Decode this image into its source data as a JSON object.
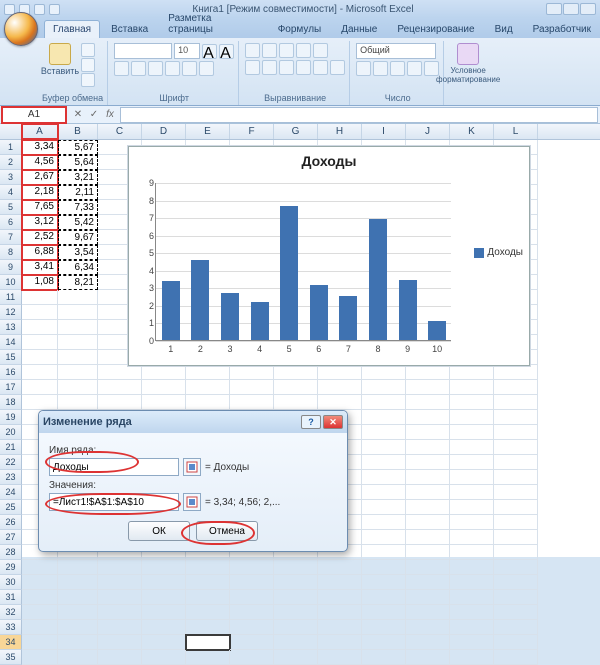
{
  "title": "Книга1  [Режим совместимости] - Microsoft Excel",
  "tabs": [
    "Главная",
    "Вставка",
    "Разметка страницы",
    "Формулы",
    "Данные",
    "Рецензирование",
    "Вид",
    "Разработчик"
  ],
  "active_tab": 0,
  "ribbon": {
    "clipboard": {
      "label": "Буфер обмена",
      "paste": "Вставить"
    },
    "font": {
      "label": "Шрифт",
      "name": "",
      "size": "10"
    },
    "align": {
      "label": "Выравнивание"
    },
    "number": {
      "label": "Число",
      "fmt": "Общий"
    },
    "styles": {
      "label": "",
      "cond": "Условное форматирование"
    }
  },
  "namebox": "A1",
  "columns": [
    "A",
    "B",
    "C",
    "D",
    "E",
    "F",
    "G",
    "H",
    "I",
    "J",
    "K",
    "L"
  ],
  "rows": [
    "1",
    "2",
    "3",
    "4",
    "5",
    "6",
    "7",
    "8",
    "9",
    "10",
    "11",
    "12",
    "13",
    "14",
    "15",
    "16",
    "17",
    "18",
    "19",
    "20",
    "21",
    "22",
    "23",
    "24",
    "25",
    "26",
    "27",
    "28",
    "29",
    "30",
    "31",
    "32",
    "33",
    "34",
    "35"
  ],
  "data_rows": [
    {
      "a": "3,34",
      "b": "5,67"
    },
    {
      "a": "4,56",
      "b": "5,64"
    },
    {
      "a": "2,67",
      "b": "3,21"
    },
    {
      "a": "2,18",
      "b": "2,11"
    },
    {
      "a": "7,65",
      "b": "7,33"
    },
    {
      "a": "3,12",
      "b": "5,42"
    },
    {
      "a": "2,52",
      "b": "9,67"
    },
    {
      "a": "6,88",
      "b": "3,54"
    },
    {
      "a": "3,41",
      "b": "6,34"
    },
    {
      "a": "1,08",
      "b": "8,21"
    }
  ],
  "chart_data": {
    "type": "bar",
    "title": "Доходы",
    "legend": "Доходы",
    "categories": [
      "1",
      "2",
      "3",
      "4",
      "5",
      "6",
      "7",
      "8",
      "9",
      "10"
    ],
    "values": [
      3.34,
      4.56,
      2.67,
      2.18,
      7.65,
      3.12,
      2.52,
      6.88,
      3.41,
      1.08
    ],
    "yticks": [
      0,
      1,
      2,
      3,
      4,
      5,
      6,
      7,
      8,
      9
    ],
    "ylim": [
      0,
      9
    ]
  },
  "dialog": {
    "title": "Изменение ряда",
    "name_label": "Имя ряда:",
    "name_value": "Доходы",
    "name_preview": "= Доходы",
    "values_label": "Значения:",
    "values_value": "=Лист1!$A$1:$A$10",
    "values_preview": "= 3,34; 4,56; 2,...",
    "ok": "ОК",
    "cancel": "Отмена"
  }
}
